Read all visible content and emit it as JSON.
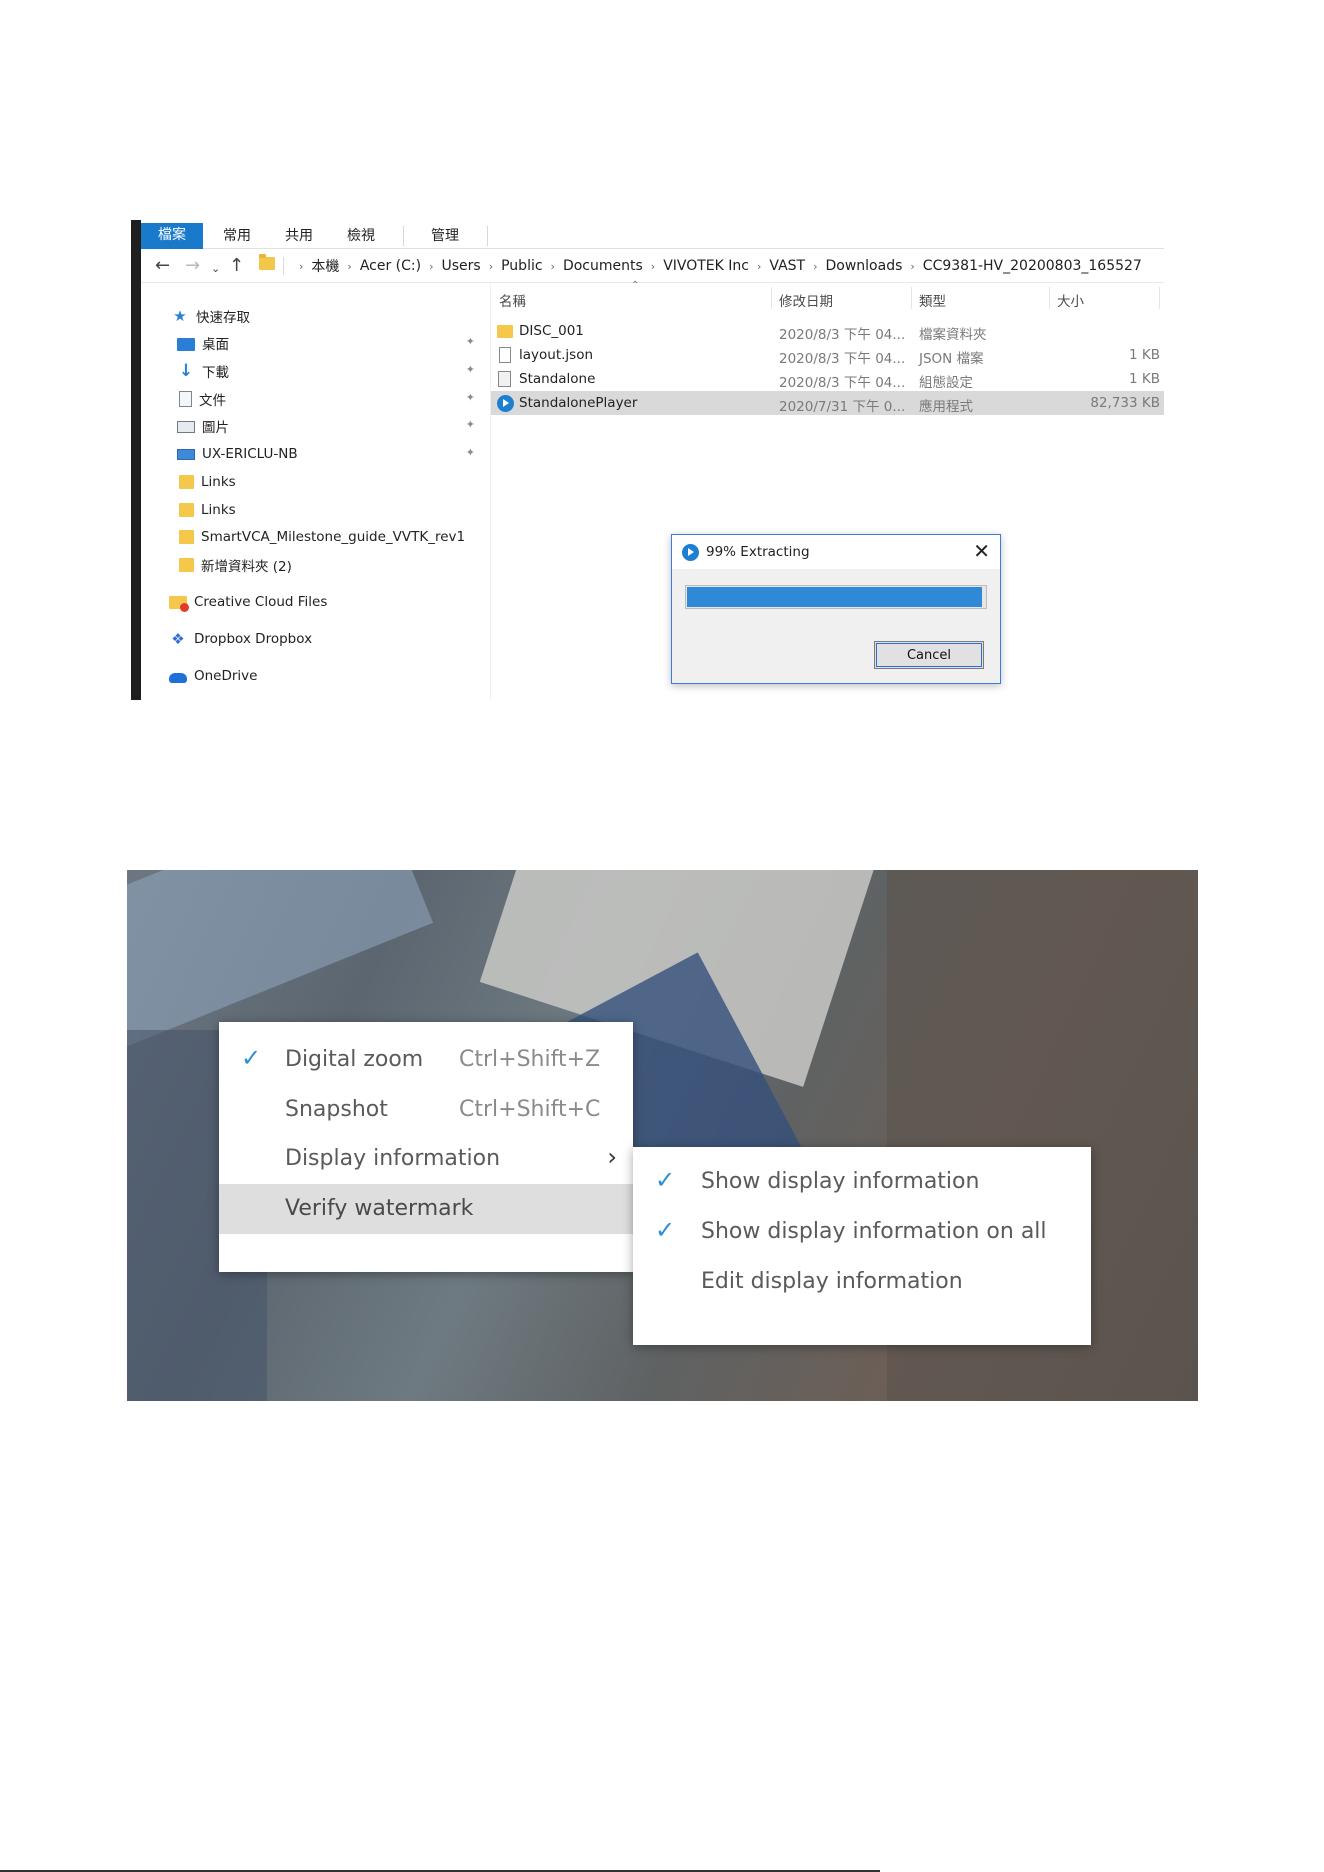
{
  "explorer": {
    "ribbon_tabs": [
      "檔案",
      "常用",
      "共用",
      "檢視",
      "管理"
    ],
    "breadcrumbs": [
      "本機",
      "Acer (C:)",
      "Users",
      "Public",
      "Documents",
      "VIVOTEK Inc",
      "VAST",
      "Downloads",
      "CC9381-HV_20200803_165527"
    ],
    "nav_tree": [
      {
        "label": "快速存取",
        "icon": "star-icon",
        "pinned": false
      },
      {
        "label": "桌面",
        "icon": "desktop-icon",
        "pinned": true
      },
      {
        "label": "下載",
        "icon": "download-icon",
        "pinned": true
      },
      {
        "label": "文件",
        "icon": "document-icon",
        "pinned": true
      },
      {
        "label": "圖片",
        "icon": "picture-icon",
        "pinned": true
      },
      {
        "label": "UX-ERICLU-NB",
        "icon": "computer-icon",
        "pinned": true
      },
      {
        "label": "Links",
        "icon": "folder-icon",
        "pinned": false
      },
      {
        "label": "Links",
        "icon": "folder-icon",
        "pinned": false
      },
      {
        "label": "SmartVCA_Milestone_guide_VVTK_rev1",
        "icon": "folder-icon",
        "pinned": false
      },
      {
        "label": "新增資料夾 (2)",
        "icon": "folder-icon",
        "pinned": false
      },
      {
        "label": "Creative Cloud Files",
        "icon": "creative-cloud-icon",
        "pinned": false
      },
      {
        "label": "Dropbox Dropbox",
        "icon": "dropbox-icon",
        "pinned": false
      },
      {
        "label": "OneDrive",
        "icon": "onedrive-icon",
        "pinned": false
      }
    ],
    "columns": [
      "名稱",
      "修改日期",
      "類型",
      "大小"
    ],
    "files": [
      {
        "name": "DISC_001",
        "date": "2020/8/3 下午 04...",
        "type": "檔案資料夾",
        "size": "",
        "icon": "folder-icon"
      },
      {
        "name": "layout.json",
        "date": "2020/8/3 下午 04...",
        "type": "JSON 檔案",
        "size": "1 KB",
        "icon": "file-icon"
      },
      {
        "name": "Standalone",
        "date": "2020/8/3 下午 04...",
        "type": "組態設定",
        "size": "1 KB",
        "icon": "config-file-icon"
      },
      {
        "name": "StandalonePlayer",
        "date": "2020/7/31 下午 0...",
        "type": "應用程式",
        "size": "82,733 KB",
        "icon": "app-icon",
        "selected": true
      }
    ],
    "dialog": {
      "title": "99% Extracting",
      "progress": 0.99,
      "cancel_label": "Cancel",
      "accent": "#2e8ad6"
    }
  },
  "player_menu": {
    "items": [
      {
        "label": "Digital zoom",
        "shortcut": "Ctrl+Shift+Z",
        "checked": true,
        "submenu": false,
        "highlighted": false
      },
      {
        "label": "Snapshot",
        "shortcut": "Ctrl+Shift+C",
        "checked": false,
        "submenu": false,
        "highlighted": false
      },
      {
        "label": "Display information",
        "shortcut": "",
        "checked": false,
        "submenu": true,
        "highlighted": false
      },
      {
        "label": "Verify watermark",
        "shortcut": "",
        "checked": false,
        "submenu": false,
        "highlighted": true
      }
    ],
    "submenu": [
      {
        "label": "Show display information",
        "checked": true
      },
      {
        "label": "Show display information on all",
        "checked": true
      },
      {
        "label": "Edit display information",
        "checked": false
      }
    ],
    "check_color": "#2b8ed6"
  }
}
